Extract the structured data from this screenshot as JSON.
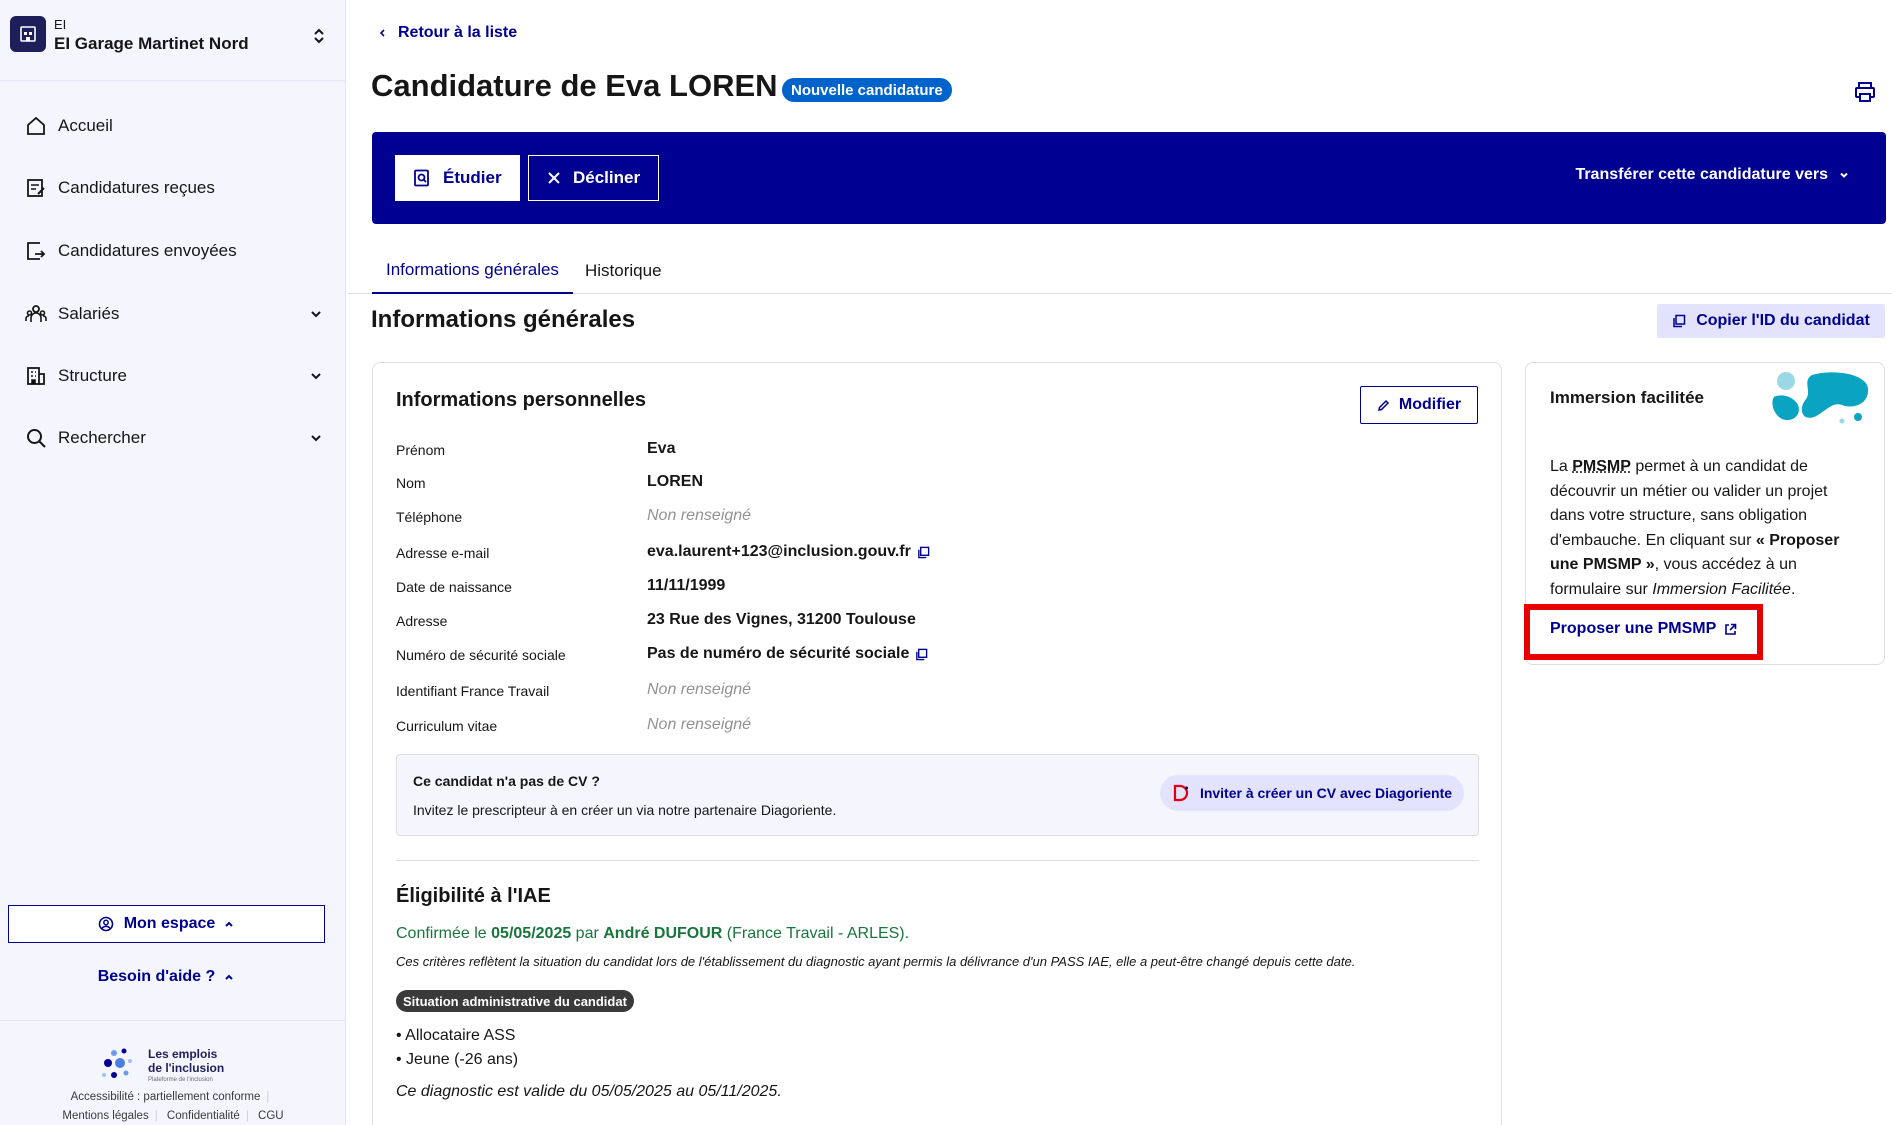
{
  "sidebar": {
    "org_type": "EI",
    "org_name": "EI Garage Martinet Nord",
    "nav": [
      {
        "label": "Accueil",
        "icon": "home-icon"
      },
      {
        "label": "Candidatures reçues",
        "icon": "edit-document-icon"
      },
      {
        "label": "Candidatures envoyées",
        "icon": "send-document-icon"
      },
      {
        "label": "Salariés",
        "icon": "team-icon"
      },
      {
        "label": "Structure",
        "icon": "building-icon"
      },
      {
        "label": "Rechercher",
        "icon": "search-icon"
      }
    ],
    "mon_espace": "Mon espace",
    "besoin_aide": "Besoin d'aide ?",
    "brand_line1": "Les emplois",
    "brand_line2": "de l'inclusion",
    "brand_sub": "Plateforme de l'inclusion",
    "footer_row1": "Accessibilité : partiellement conforme",
    "footer_links": [
      "Mentions légales",
      "Confidentialité",
      "CGU"
    ]
  },
  "main": {
    "back_link": "Retour à la liste",
    "title": "Candidature de Eva LOREN",
    "status_badge": "Nouvelle candidature",
    "actions": {
      "study": "Étudier",
      "decline": "Décliner",
      "transfer": "Transférer cette candidature vers"
    },
    "tabs": [
      "Informations générales",
      "Historique"
    ],
    "section_title": "Informations générales",
    "copy_id": "Copier l'ID du candidat",
    "personal": {
      "title": "Informations personnelles",
      "edit": "Modifier",
      "rows": [
        {
          "label": "Prénom",
          "value": "Eva"
        },
        {
          "label": "Nom",
          "value": "LOREN"
        },
        {
          "label": "Téléphone",
          "value": "Non renseigné"
        },
        {
          "label": "Adresse e-mail",
          "value": "eva.laurent+123@inclusion.gouv.fr"
        },
        {
          "label": "Date de naissance",
          "value": "11/11/1999"
        },
        {
          "label": "Adresse",
          "value": "23 Rue des Vignes, 31200 Toulouse"
        },
        {
          "label": "Numéro de sécurité sociale",
          "value": "Pas de numéro de sécurité sociale"
        },
        {
          "label": "Identifiant France Travail",
          "value": "Non renseigné"
        },
        {
          "label": "Curriculum vitae",
          "value": "Non renseigné"
        }
      ],
      "cv_title": "Ce candidat n'a pas de CV ?",
      "cv_text": "Invitez le prescripteur à en créer un via notre partenaire Diagoriente.",
      "cv_button": "Inviter à créer un CV avec Diagoriente"
    },
    "eligibility": {
      "title": "Éligibilité à l'IAE",
      "confirm_prefix": "Confirmée le ",
      "confirm_date": "05/05/2025",
      "confirm_by": " par ",
      "confirm_name": "André DUFOUR",
      "confirm_org": " (France Travail - ARLES).",
      "note": "Ces critères reflètent la situation du candidat lors de l'établissement du diagnostic ayant permis la délivrance d'un PASS IAE, elle a peut-être changé depuis cette date.",
      "badge": "Situation administrative du candidat",
      "criteria": [
        "Allocataire ASS",
        "Jeune (-26 ans)"
      ],
      "validity": "Ce diagnostic est valide du 05/05/2025 au 05/11/2025."
    },
    "immersion": {
      "title": "Immersion facilitée",
      "t1": "La ",
      "t_pmsmp": "PMSMP",
      "t2": " permet à un candidat de découvrir un métier ou valider un projet dans votre structure, sans obligation d'embauche. En cliquant sur ",
      "t_bold": "« Proposer une PMSMP »",
      "t3": ", vous accédez à un formulaire sur ",
      "t_italic": "Immersion Facilitée",
      "t4": ".",
      "link": "Proposer une PMSMP"
    }
  },
  "colors": {
    "primary": "#000091",
    "badge_blue": "#0063cb",
    "success_green": "#18753c",
    "highlight_red": "#e60000"
  }
}
